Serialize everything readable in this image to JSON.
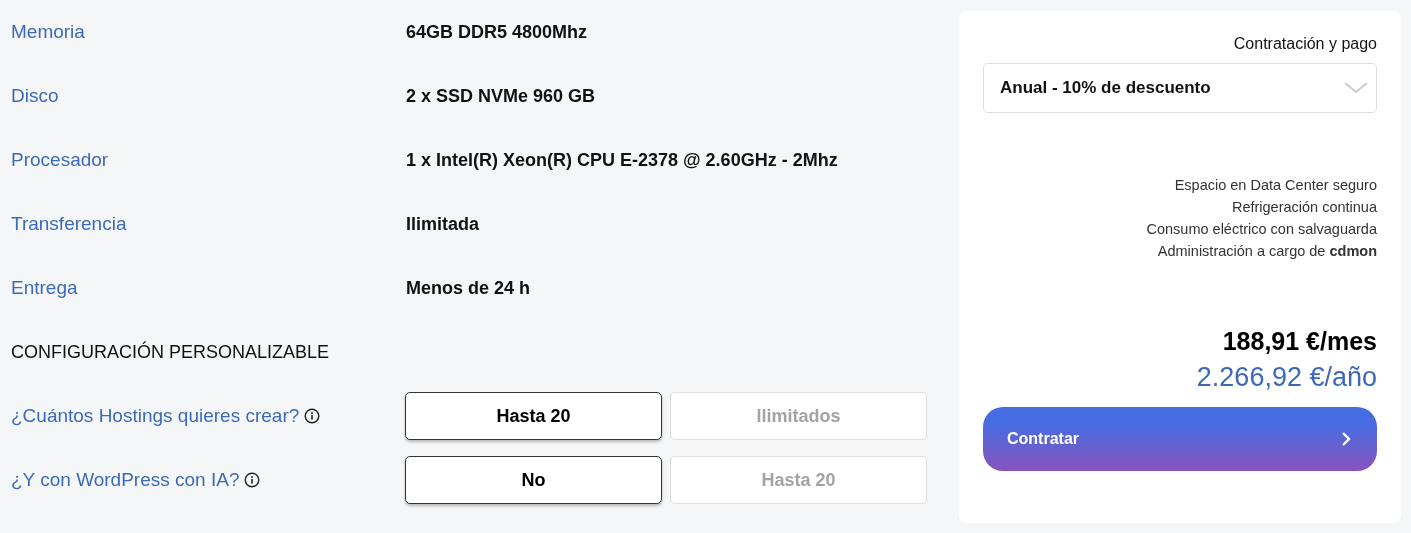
{
  "specs": [
    {
      "label": "Memoria",
      "value": "64GB DDR5 4800Mhz"
    },
    {
      "label": "Disco",
      "value": "2 x SSD NVMe 960 GB"
    },
    {
      "label": "Procesador",
      "value": "1 x Intel(R) Xeon(R) CPU E-2378 @ 2.60GHz - 2Mhz"
    },
    {
      "label": "Transferencia",
      "value": "Ilimitada"
    },
    {
      "label": "Entrega",
      "value": "Menos de 24 h"
    }
  ],
  "config": {
    "heading": "CONFIGURACIÓN PERSONALIZABLE",
    "questions": [
      {
        "label": "¿Cuántos Hostings quieres crear?",
        "options": [
          {
            "label": "Hasta 20",
            "selected": true
          },
          {
            "label": "Ilimitados",
            "selected": false
          }
        ]
      },
      {
        "label": "¿Y con WordPress con IA?",
        "options": [
          {
            "label": "No",
            "selected": true
          },
          {
            "label": "Hasta 20",
            "selected": false
          }
        ]
      }
    ]
  },
  "order": {
    "title": "Contratación y pago",
    "plan_select": {
      "value": "Anual - 10% de descuento"
    },
    "features": [
      "Espacio en Data Center seguro",
      "Refrigeración continua",
      "Consumo eléctrico con salvaguarda",
      "Administración a cargo de **cdmon**"
    ],
    "price_month": "188,91 €/mes",
    "price_year": "2.266,92 €/año",
    "button": "Contratar"
  }
}
